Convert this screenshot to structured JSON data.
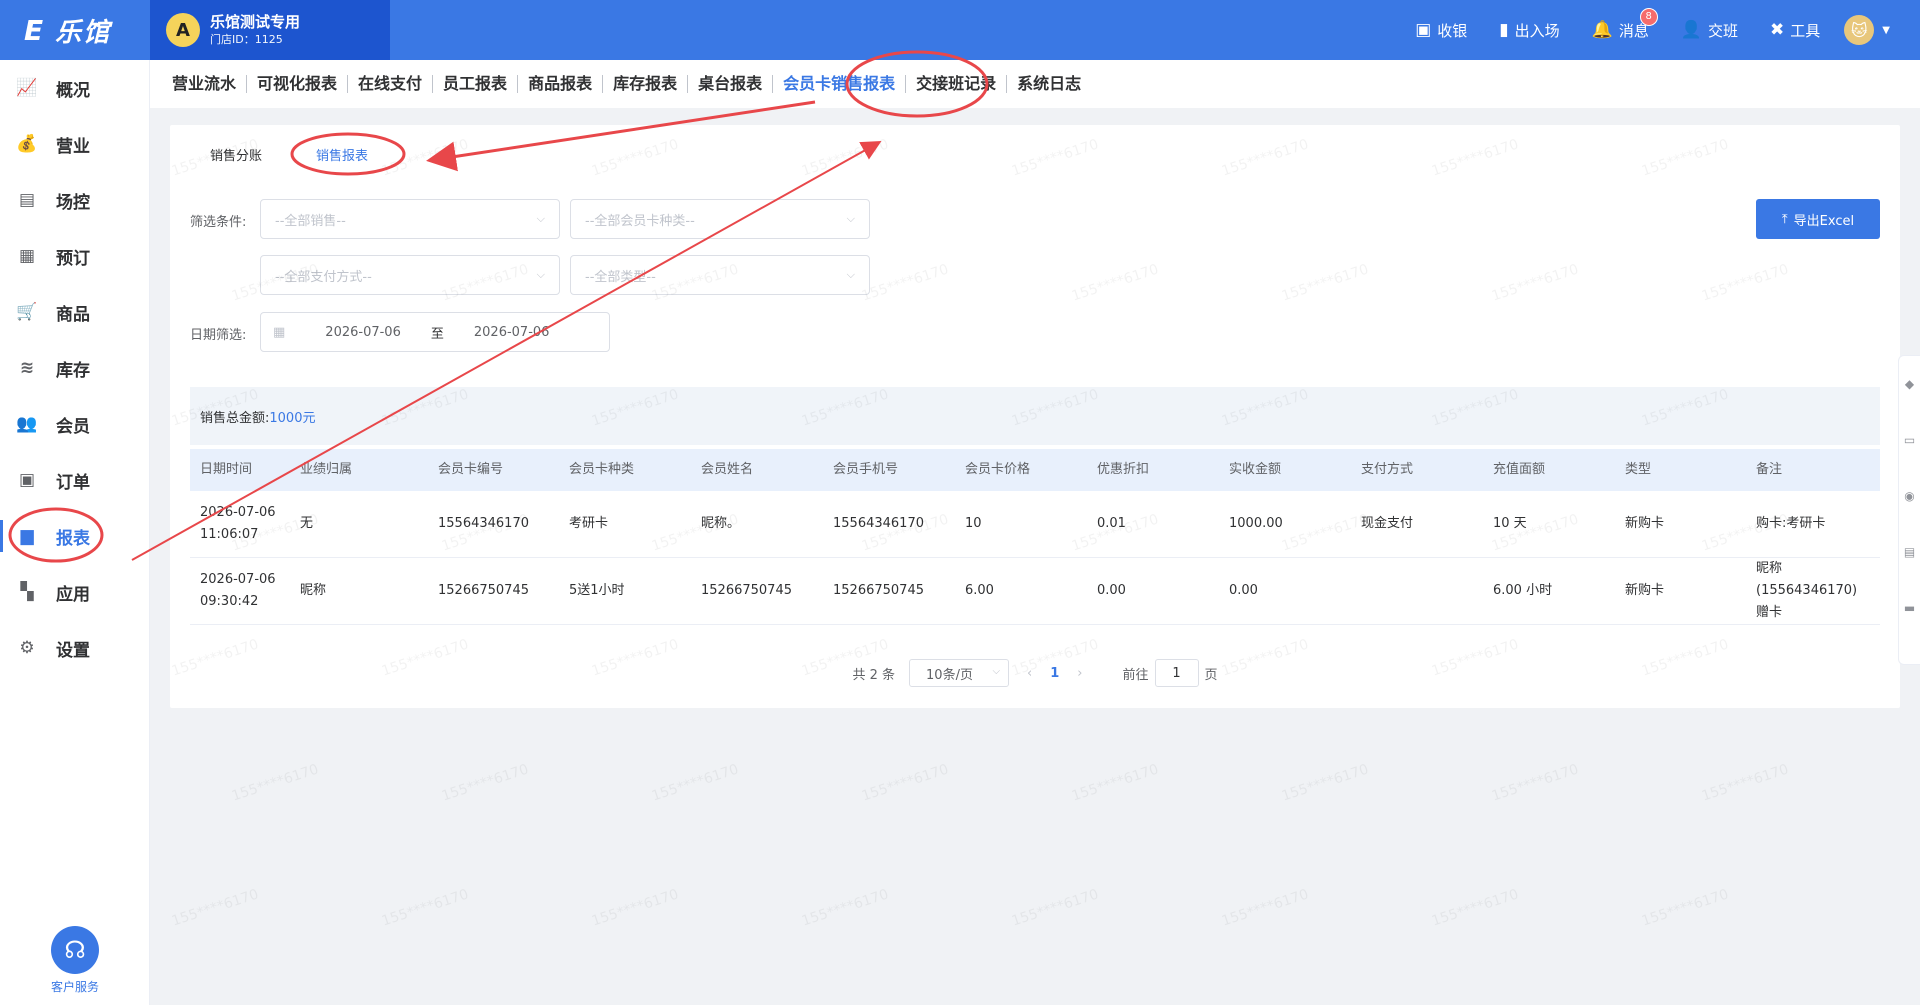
{
  "brand": {
    "logo_text": "乐馆",
    "logo_mark": "E"
  },
  "store": {
    "name": "乐馆测试专用",
    "id_label": "门店ID：1125",
    "avatar_letter": "A"
  },
  "top_actions": [
    {
      "name": "cashier",
      "label": "收银",
      "icon": "cashier-icon",
      "glyph": "▣"
    },
    {
      "name": "entry-exit",
      "label": "出入场",
      "icon": "door-icon",
      "glyph": "▮"
    },
    {
      "name": "messages",
      "label": "消息",
      "icon": "bell-icon",
      "glyph": "🔔",
      "badge": "8"
    },
    {
      "name": "handover",
      "label": "交班",
      "icon": "user-switch-icon",
      "glyph": "👤"
    },
    {
      "name": "tools",
      "label": "工具",
      "icon": "tools-icon",
      "glyph": "✖"
    }
  ],
  "sidebar": {
    "items": [
      {
        "key": "overview",
        "label": "概况",
        "icon": "chart-line-icon",
        "glyph": "📈"
      },
      {
        "key": "business",
        "label": "营业",
        "icon": "money-bag-icon",
        "glyph": "💰"
      },
      {
        "key": "venue",
        "label": "场控",
        "icon": "venue-icon",
        "glyph": "▤"
      },
      {
        "key": "booking",
        "label": "预订",
        "icon": "calendar-icon",
        "glyph": "▦"
      },
      {
        "key": "goods",
        "label": "商品",
        "icon": "cart-icon",
        "glyph": "🛒"
      },
      {
        "key": "stock",
        "label": "库存",
        "icon": "layers-icon",
        "glyph": "≋"
      },
      {
        "key": "member",
        "label": "会员",
        "icon": "members-icon",
        "glyph": "👥"
      },
      {
        "key": "order",
        "label": "订单",
        "icon": "order-icon",
        "glyph": "▣"
      },
      {
        "key": "report",
        "label": "报表",
        "icon": "bar-chart-icon",
        "glyph": "▆",
        "active": true
      },
      {
        "key": "apps",
        "label": "应用",
        "icon": "apps-icon",
        "glyph": "▚"
      },
      {
        "key": "settings",
        "label": "设置",
        "icon": "gear-icon",
        "glyph": "⚙"
      }
    ],
    "service_label": "客户服务"
  },
  "tabs": [
    {
      "label": "营业流水"
    },
    {
      "label": "可视化报表"
    },
    {
      "label": "在线支付"
    },
    {
      "label": "员工报表"
    },
    {
      "label": "商品报表"
    },
    {
      "label": "库存报表"
    },
    {
      "label": "桌台报表"
    },
    {
      "label": "会员卡销售报表",
      "active": true
    },
    {
      "label": "交接班记录"
    },
    {
      "label": "系统日志"
    }
  ],
  "subtabs": [
    {
      "label": "销售分账"
    },
    {
      "label": "销售报表",
      "active": true
    }
  ],
  "filters": {
    "label": "筛选条件:",
    "sales_placeholder": "--全部销售--",
    "card_type_placeholder": "--全部会员卡种类--",
    "pay_method_placeholder": "--全部支付方式--",
    "type_placeholder": "--全部类型--",
    "date_label": "日期筛选:",
    "date_start": "2026-07-06",
    "date_sep": "至",
    "date_end": "2026-07-06",
    "export_label": "导出Excel"
  },
  "summary": {
    "label": "销售总金额:",
    "amount": "1000元"
  },
  "table": {
    "headers": [
      "日期时间",
      "业绩归属",
      "会员卡编号",
      "会员卡种类",
      "会员姓名",
      "会员手机号",
      "会员卡价格",
      "优惠折扣",
      "实收金额",
      "支付方式",
      "充值面额",
      "类型",
      "备注"
    ],
    "rows": [
      [
        "2026-07-06 11:06:07",
        "无",
        "15564346170",
        "考研卡",
        "昵称。",
        "15564346170",
        "10",
        "0.01",
        "1000.00",
        "现金支付",
        "10 天",
        "新购卡",
        "购卡:考研卡"
      ],
      [
        "2026-07-06 09:30:42",
        "昵称",
        "15266750745",
        "5送1小时",
        "15266750745",
        "15266750745",
        "6.00",
        "0.00",
        "0.00",
        "",
        "6.00 小时",
        "新购卡",
        "昵称(15564346170)赠卡"
      ]
    ]
  },
  "pagination": {
    "total": "共 2 条",
    "page_size": "10条/页",
    "current": "1",
    "goto_label": "前往",
    "goto_value": "1",
    "page_suffix": "页"
  },
  "colors": {
    "primary": "#3a78e4",
    "annotation": "#e8474a"
  }
}
